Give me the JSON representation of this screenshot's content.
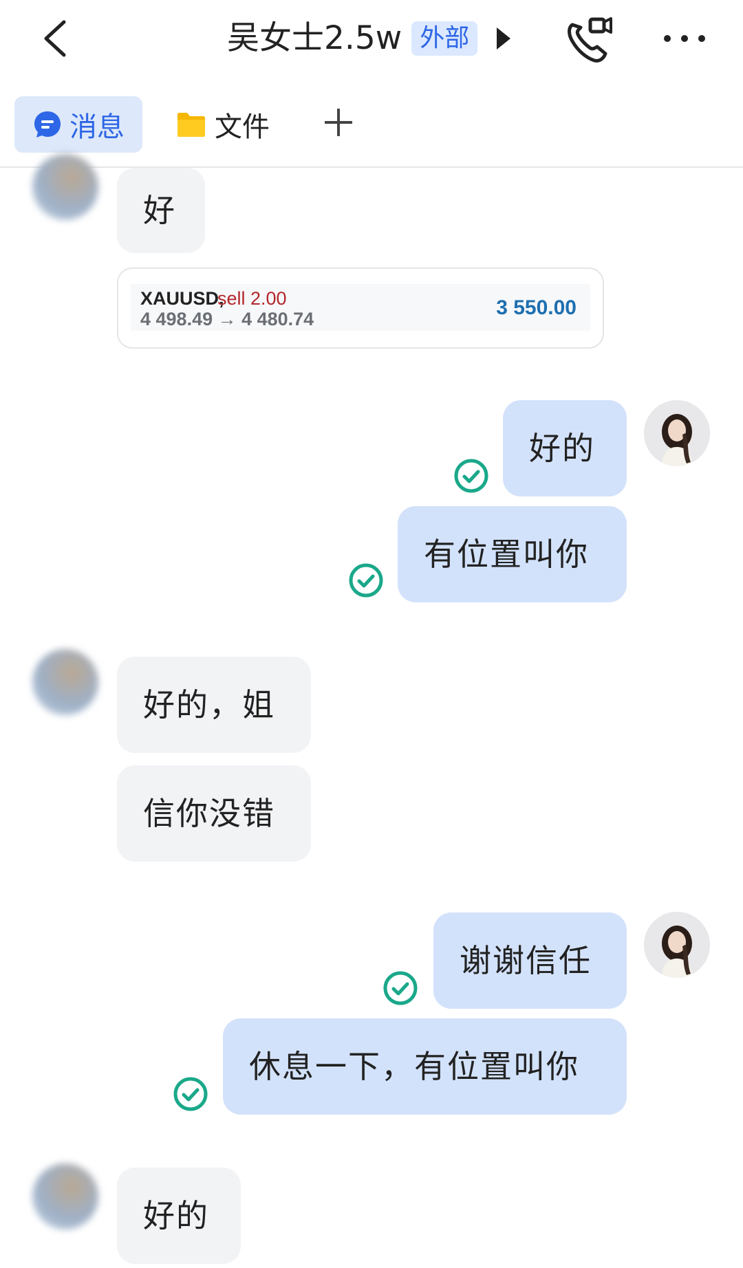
{
  "header": {
    "title": "吴女士2.5w",
    "badge": "外部"
  },
  "tabs": {
    "messages_label": "消息",
    "files_label": "文件"
  },
  "messages": [
    {
      "side": "in",
      "text": "好"
    },
    {
      "side": "in",
      "type": "trade-card",
      "symbol": "XAUUSD,",
      "action": "sell 2.00",
      "prices": "4 498.49 → 4 480.74",
      "profit": "3 550.00"
    },
    {
      "side": "out",
      "text": "好的"
    },
    {
      "side": "out",
      "text": "有位置叫你"
    },
    {
      "side": "in",
      "text": "好的，姐"
    },
    {
      "side": "in",
      "text": "信你没错"
    },
    {
      "side": "out",
      "text": "谢谢信任"
    },
    {
      "side": "out",
      "text": "休息一下，有位置叫你"
    },
    {
      "side": "in",
      "text": "好的"
    }
  ],
  "colors": {
    "accent": "#2d66e6",
    "outgoing_bubble": "#d3e2fb",
    "incoming_bubble": "#f2f3f5",
    "read_check": "#1aa88a",
    "sell_red": "#b3262a",
    "profit_blue": "#1d6fb0"
  }
}
